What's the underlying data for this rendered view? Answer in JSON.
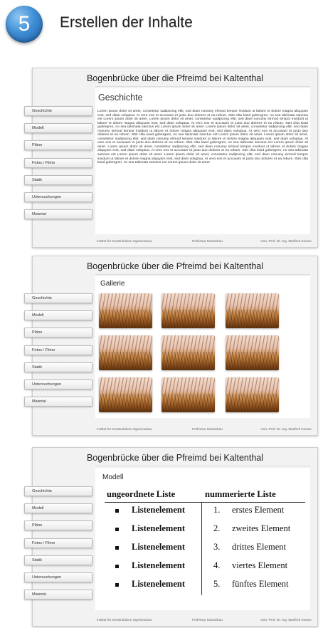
{
  "step": {
    "number": "5",
    "title": "Erstellen der Inhalte"
  },
  "screens": {
    "title": "Bogenbrücke über die Pfreimd bei Kaltenthal",
    "nav": [
      "Geschichte",
      "Modell",
      "Pläne",
      "Fotos / Filme",
      "Statik",
      "Untersuchungen",
      "Material"
    ],
    "footer": {
      "left": "Institut für Konstruktiven Ingenieurbau",
      "center": "Professur Massivbau",
      "right": "Univ.-Prof. Dr.-Ing. Manfred Keuser"
    }
  },
  "screen1": {
    "heading": "Geschichte",
    "body": "Lorem ipsum dolor sit amet, consetetur sadipscing elitr, sed diam nonumy eirmod tempor invidunt ut labore et dolore magna aliquyam erat, sed diam voluptua. At vero eos et accusam et justo duo dolores et ea rebum. Stet clita kasd gubergren, no sea takimata sanctus est Lorem ipsum dolor sit amet. Lorem ipsum dolor sit amet, consetetur sadipscing elitr, sed diam nonumy eirmod tempor invidunt ut labore et dolore magna aliquyam erat, sed diam voluptua. At vero eos et accusam et justo duo dolores et ea rebum. Stet clita kasd gubergren, no sea takimata sanctus est Lorem ipsum dolor sit amet. Lorem ipsum dolor sit amet, consetetur sadipscing elitr, sed diam nonumy eirmod tempor invidunt ut labore et dolore magna aliquyam erat, sed diam voluptua. At vero eos et accusam et justo duo dolores et ea rebum. Stet clita kasd gubergren, no sea takimata sanctus est Lorem ipsum dolor sit amet. Lorem ipsum dolor sit amet, consetetur sadipscing elitr, sed diam nonumy eirmod tempor invidunt ut labore et dolore magna aliquyam erat, sed diam voluptua. At vero eos et accusam et justo duo dolores et ea rebum. Stet clita kasd gubergren, no sea takimata sanctus est Lorem ipsum dolor sit amet. Lorem ipsum dolor sit amet, consetetur sadipscing elitr, sed diam nonumy eirmod tempor invidunt ut labore et dolore magna aliquyam erat, sed diam voluptua. At vero eos et accusam et justo duo dolores et ea rebum. Stet clita kasd gubergren, no sea takimata sanctus est Lorem ipsum dolor sit amet. Lorem ipsum dolor sit amet, consetetur sadipscing elitr, sed diam nonumy eirmod tempor invidunt ut labore et dolore magna aliquyam erat, sed diam voluptua. At vero eos et accusam et justo duo dolores et ea rebum. Stet clita kasd gubergren, no sea takimata sanctus est Lorem ipsum dolor sit amet."
  },
  "screen2": {
    "heading": "Gallerie"
  },
  "screen3": {
    "heading": "Modell",
    "ul_header": "ungeordnete Liste",
    "ol_header": "nummerierte Liste",
    "ul_items": [
      "Listenelement",
      "Listenelement",
      "Listenelement",
      "Listenelement",
      "Listenelement"
    ],
    "ol_numbers": [
      "1.",
      "2.",
      "3.",
      "4.",
      "5."
    ],
    "ol_items": [
      "erstes Element",
      "zweites Element",
      "drittes Element",
      "viertes Element",
      "fünftes Element"
    ]
  }
}
